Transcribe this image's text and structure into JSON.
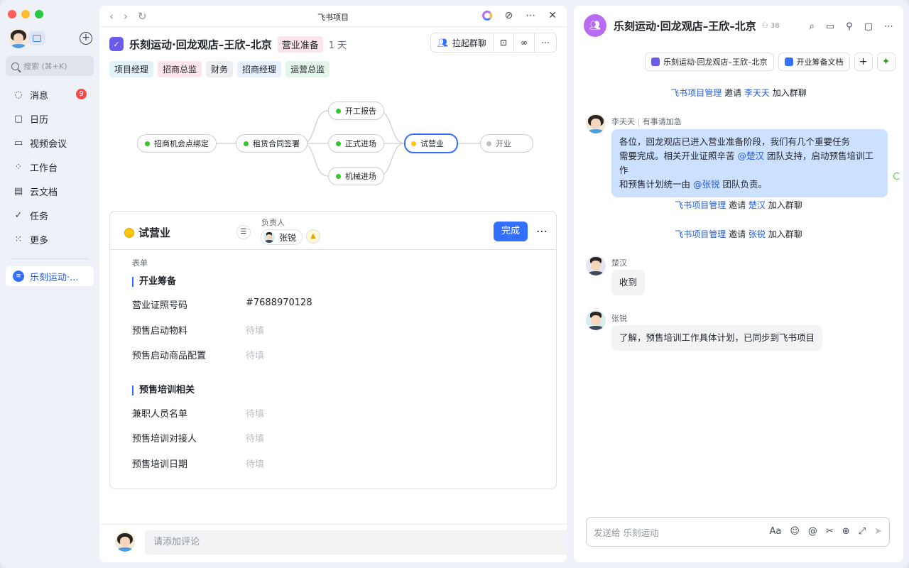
{
  "window": {
    "title": "飞书项目"
  },
  "sidebar": {
    "search_placeholder": "搜索 (⌘+K)",
    "items": [
      {
        "label": "消息",
        "icon": "chat-bubble-icon",
        "badge": "9"
      },
      {
        "label": "日历",
        "icon": "calendar-icon"
      },
      {
        "label": "视频会议",
        "icon": "video-camera-icon"
      },
      {
        "label": "工作台",
        "icon": "apps-grid-icon"
      },
      {
        "label": "云文档",
        "icon": "document-icon"
      },
      {
        "label": "任务",
        "icon": "task-check-icon"
      },
      {
        "label": "更多",
        "icon": "more-dots-icon"
      }
    ],
    "active_project": "乐刻运动·..."
  },
  "project": {
    "name": "乐刻运动·回龙观店–王欣–北京",
    "stage": "营业准备",
    "days": "1 天",
    "actions": {
      "group_chat": "拉起群聊"
    },
    "roles": [
      {
        "label": "项目经理",
        "color": "#e1f3f8"
      },
      {
        "label": "招商总监",
        "color": "#fde4ea"
      },
      {
        "label": "财务",
        "color": "#eceef2"
      },
      {
        "label": "招商经理",
        "color": "#e6f0ff"
      },
      {
        "label": "运营总监",
        "color": "#e3f4e8"
      }
    ]
  },
  "flow": {
    "nodes": [
      "招商机会点绑定",
      "租赁合同签署",
      "开工报告",
      "正式进场",
      "机械进场",
      "试营业",
      "开业"
    ],
    "active": "试营业"
  },
  "task_card": {
    "title": "试营业",
    "owner_label": "负责人",
    "owner_name": "张锐",
    "done_label": "完成",
    "form_label": "表单",
    "sections": [
      {
        "title": "开业筹备",
        "rows": [
          {
            "label": "营业证照号码",
            "value": "#7688970128"
          },
          {
            "label": "预售启动物料",
            "value": "待填"
          },
          {
            "label": "预售启动商品配置",
            "value": "待填"
          }
        ]
      },
      {
        "title": "预售培训相关",
        "rows": [
          {
            "label": "兼职人员名单",
            "value": "待填"
          },
          {
            "label": "预售培训对接人",
            "value": "待填"
          },
          {
            "label": "预售培训日期",
            "value": "待填"
          }
        ]
      }
    ]
  },
  "comment": {
    "placeholder": "请添加评论"
  },
  "chat": {
    "group_name": "乐刻运动·回龙观店–王欣–北京",
    "member_count": "38",
    "tabs": [
      "乐刻运动·回龙观店–王欣–北京",
      "开业筹备文档"
    ],
    "sys1": {
      "who": "飞书项目管理",
      "verb": "邀请",
      "target": "李天天",
      "tail": "加入群聊"
    },
    "msg1": {
      "name": "李天天",
      "status": "有事请加急",
      "line1": "各位，回龙观店已进入营业准备阶段，我们有几个重要任务",
      "line2a": "需要完成。相关开业证照辛苦 ",
      "mention1": "@楚汉",
      "line2b": " 团队支持，启动预售培训工作",
      "line3a": "和预售计划统一由 ",
      "mention2": "@张锐",
      "line3b": " 团队负责。"
    },
    "sys2": {
      "who": "飞书项目管理",
      "verb": "邀请",
      "target": "楚汉",
      "tail": "加入群聊"
    },
    "sys3": {
      "who": "飞书项目管理",
      "verb": "邀请",
      "target": "张锐",
      "tail": "加入群聊"
    },
    "msg2": {
      "name": "楚汉",
      "text": "收到"
    },
    "msg3": {
      "name": "张锐",
      "text": "了解，预售培训工作具体计划，已同步到飞书项目"
    },
    "input_placeholder": "发送给 乐刻运动"
  }
}
